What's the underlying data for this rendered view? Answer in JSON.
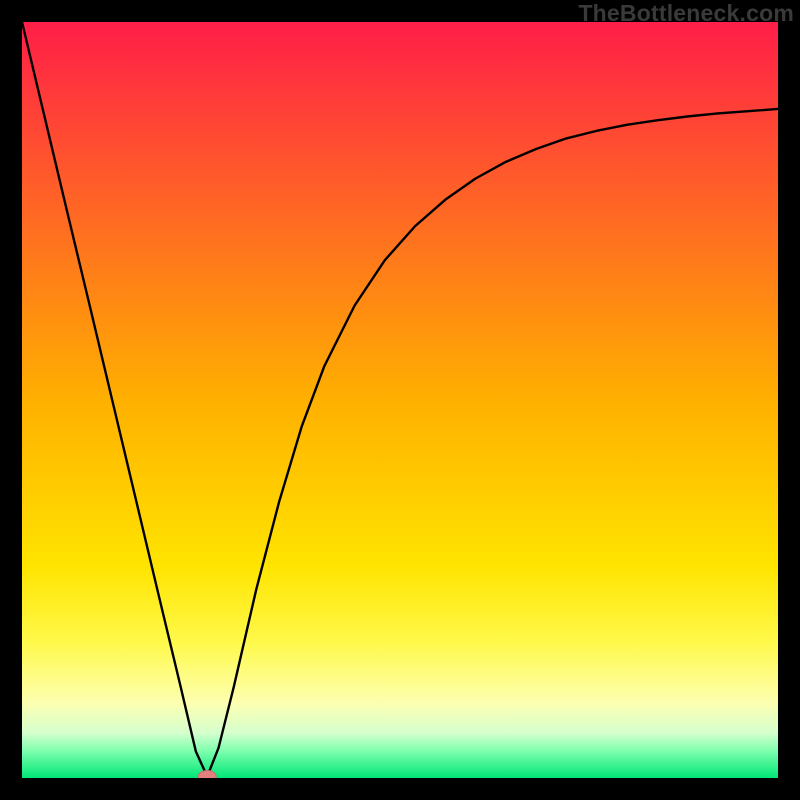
{
  "attribution": "TheBottleneck.com",
  "chart_data": {
    "type": "line",
    "title": "",
    "xlabel": "",
    "ylabel": "",
    "xlim": [
      0,
      100
    ],
    "ylim": [
      0,
      100
    ],
    "gradient_stops": [
      {
        "offset": 0.0,
        "color": "#ff1e48"
      },
      {
        "offset": 0.5,
        "color": "#ffb000"
      },
      {
        "offset": 0.72,
        "color": "#ffe400"
      },
      {
        "offset": 0.82,
        "color": "#fff94a"
      },
      {
        "offset": 0.9,
        "color": "#fdffb0"
      },
      {
        "offset": 0.94,
        "color": "#d6ffcd"
      },
      {
        "offset": 0.965,
        "color": "#7bffad"
      },
      {
        "offset": 1.0,
        "color": "#00e676"
      }
    ],
    "series": [
      {
        "name": "bottleneck-curve",
        "x": [
          0.0,
          3.0,
          6.0,
          9.0,
          12.0,
          15.0,
          18.0,
          21.0,
          23.0,
          24.5,
          26.0,
          28.0,
          31.0,
          34.0,
          37.0,
          40.0,
          44.0,
          48.0,
          52.0,
          56.0,
          60.0,
          64.0,
          68.0,
          72.0,
          76.0,
          80.0,
          84.0,
          88.0,
          92.0,
          96.0,
          100.0
        ],
        "y": [
          100.0,
          87.4,
          74.8,
          62.3,
          49.7,
          37.1,
          24.5,
          12.0,
          3.5,
          0.2,
          4.0,
          12.0,
          25.0,
          36.5,
          46.5,
          54.5,
          62.5,
          68.5,
          73.0,
          76.5,
          79.3,
          81.5,
          83.2,
          84.6,
          85.6,
          86.4,
          87.0,
          87.5,
          87.9,
          88.2,
          88.5
        ]
      }
    ],
    "marker": {
      "x": 24.5,
      "y": 0.2,
      "name": "optimal-point",
      "color": "#e28080"
    },
    "black_border_px": 22
  }
}
